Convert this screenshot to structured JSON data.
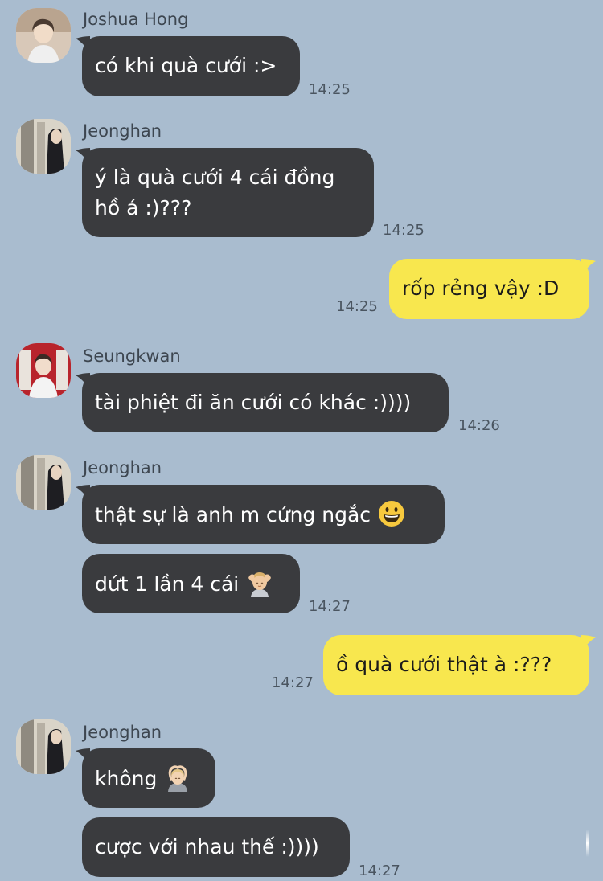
{
  "chat": {
    "messages": [
      {
        "sender": "Joshua Hong",
        "lines": [
          "có khi quà cưới :>"
        ],
        "time": "14:25"
      },
      {
        "sender": "Jeonghan",
        "lines": [
          "ý là quà cưới 4 cái đồng",
          "hồ á :)???"
        ],
        "time": "14:25"
      },
      {
        "sender": "me",
        "lines": [
          "rốp rẻng vậy :D"
        ],
        "time": "14:25"
      },
      {
        "sender": "Seungkwan",
        "lines": [
          "tài phiệt đi ăn cưới có khác :))))"
        ],
        "time": "14:26"
      },
      {
        "sender": "Jeonghan",
        "lines": [
          "thật sự là anh m cứng ngắc"
        ],
        "emoji": "grinning-face-emoji"
      },
      {
        "sender": "Jeonghan",
        "lines": [
          "dứt 1 lần 4 cái"
        ],
        "emoji": "person-massage-emoji",
        "time": "14:27"
      },
      {
        "sender": "me",
        "lines": [
          "ồ quà cưới thật à :???"
        ],
        "time": "14:27"
      },
      {
        "sender": "Jeonghan",
        "lines": [
          "không"
        ],
        "emoji": "person-gesturing-ok-emoji"
      },
      {
        "sender": "Jeonghan",
        "lines": [
          "cược với nhau thế :))))"
        ],
        "time": "14:27"
      }
    ]
  },
  "colors": {
    "background": "#a9bccf",
    "incoming_bubble": "#3a3b3e",
    "outgoing_bubble": "#f8e74e"
  }
}
